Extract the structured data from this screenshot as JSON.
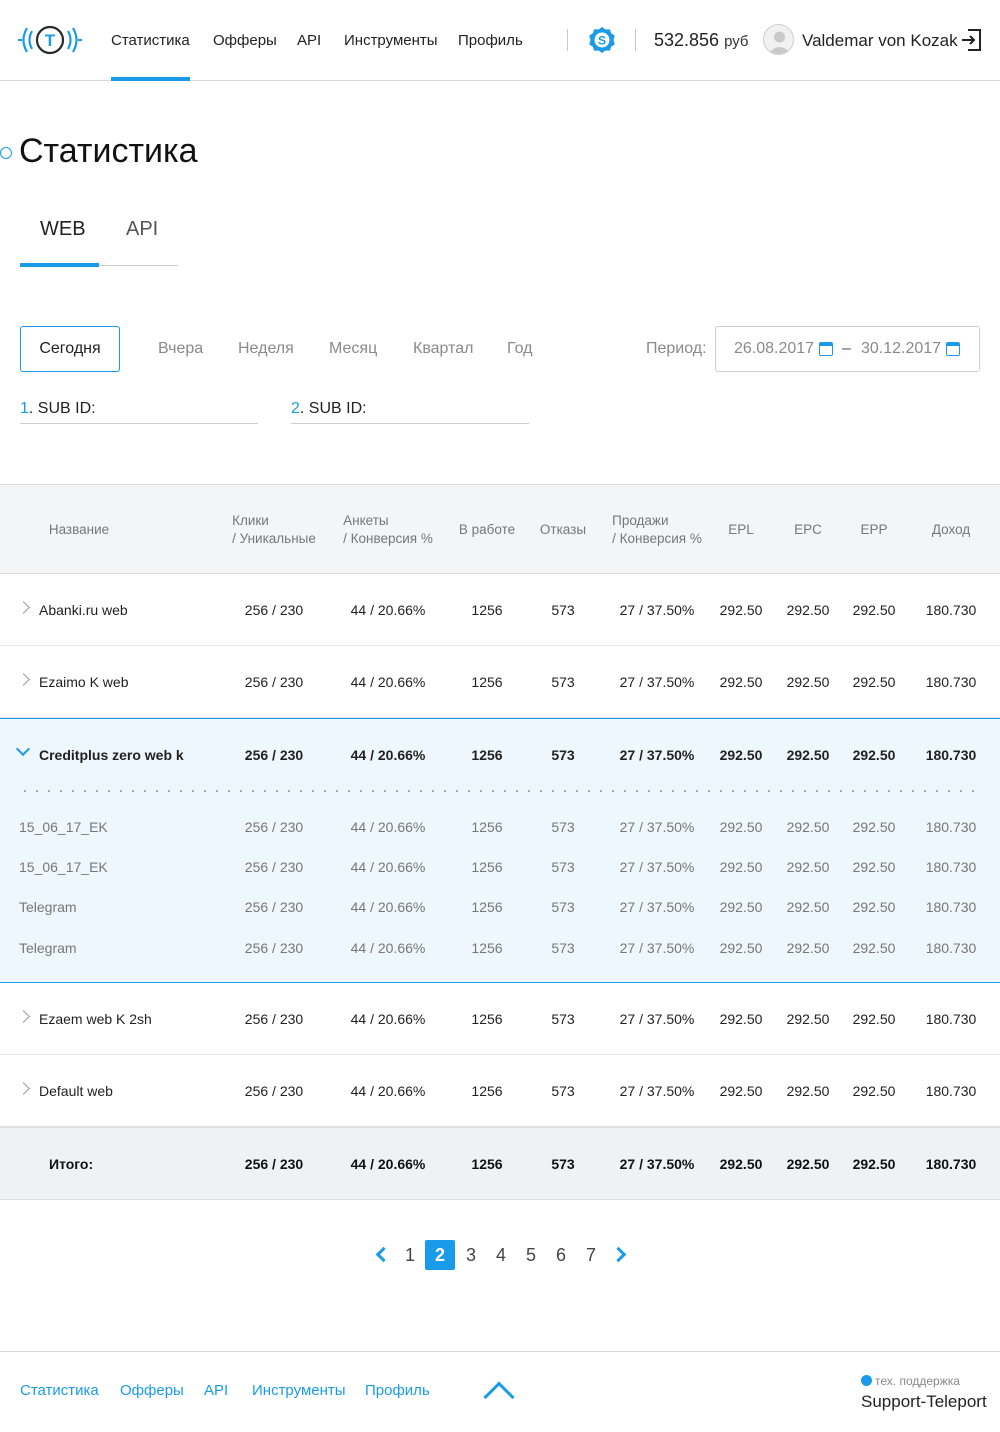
{
  "header": {
    "logo_letter": "T",
    "nav": [
      "Статистика",
      "Офферы",
      "API",
      "Инструменты",
      "Профиль"
    ],
    "balance": "532.856",
    "currency": "руб",
    "username": "Valdemar von Kozak"
  },
  "page_title": "Статистика",
  "tabs": [
    "WEB",
    "API"
  ],
  "periods": [
    "Сегодня",
    "Вчера",
    "Неделя",
    "Месяц",
    "Квартал",
    "Год"
  ],
  "period_label": "Период:",
  "date_from": "26.08.2017",
  "date_to": "30.12.2017",
  "date_dash": "–",
  "sub_ids": [
    {
      "num": "1",
      "label": ". SUB ID:"
    },
    {
      "num": "2",
      "label": ". SUB ID:"
    }
  ],
  "table": {
    "columns": [
      [
        "Название"
      ],
      [
        "Клики",
        "/ Уникальные"
      ],
      [
        "Анкеты",
        "/ Конверсия %"
      ],
      [
        "В работе"
      ],
      [
        "Отказы"
      ],
      [
        "Продажи",
        "/ Конверсия %"
      ],
      [
        "EPL"
      ],
      [
        "EPC"
      ],
      [
        "EPP"
      ],
      [
        "Доход"
      ]
    ],
    "rows": [
      [
        "Abanki.ru web",
        "256 / 230",
        "44 / 20.66%",
        "1256",
        "573",
        "27 / 37.50%",
        "292.50",
        "292.50",
        "292.50",
        "180.730"
      ],
      [
        "Ezaimo K web",
        "256 / 230",
        "44 / 20.66%",
        "1256",
        "573",
        "27 / 37.50%",
        "292.50",
        "292.50",
        "292.50",
        "180.730"
      ],
      [
        "Creditplus zero web k",
        "256 / 230",
        "44 / 20.66%",
        "1256",
        "573",
        "27 / 37.50%",
        "292.50",
        "292.50",
        "292.50",
        "180.730"
      ],
      [
        "Ezaem web K 2sh",
        "256 / 230",
        "44 / 20.66%",
        "1256",
        "573",
        "27 / 37.50%",
        "292.50",
        "292.50",
        "292.50",
        "180.730"
      ],
      [
        "Default web",
        "256 / 230",
        "44 / 20.66%",
        "1256",
        "573",
        "27 / 37.50%",
        "292.50",
        "292.50",
        "292.50",
        "180.730"
      ]
    ],
    "expanded_row_index": 2,
    "sub_rows": [
      [
        "15_06_17_EK",
        "256 / 230",
        "44 / 20.66%",
        "1256",
        "573",
        "27 / 37.50%",
        "292.50",
        "292.50",
        "292.50",
        "180.730"
      ],
      [
        "15_06_17_EK",
        "256 / 230",
        "44 / 20.66%",
        "1256",
        "573",
        "27 / 37.50%",
        "292.50",
        "292.50",
        "292.50",
        "180.730"
      ],
      [
        "Telegram",
        "256 / 230",
        "44 / 20.66%",
        "1256",
        "573",
        "27 / 37.50%",
        "292.50",
        "292.50",
        "292.50",
        "180.730"
      ],
      [
        "Telegram",
        "256 / 230",
        "44 / 20.66%",
        "1256",
        "573",
        "27 / 37.50%",
        "292.50",
        "292.50",
        "292.50",
        "180.730"
      ]
    ],
    "total": [
      "Итого:",
      "256 / 230",
      "44 / 20.66%",
      "1256",
      "573",
      "27 / 37.50%",
      "292.50",
      "292.50",
      "292.50",
      "180.730"
    ]
  },
  "pagination": {
    "pages": [
      "1",
      "2",
      "3",
      "4",
      "5",
      "6",
      "7"
    ],
    "current": "2"
  },
  "footer": {
    "links": [
      "Статистика",
      "Офферы",
      "API",
      "Инструменты",
      "Профиль"
    ],
    "support_label": "тех. поддержка",
    "support_name": "Support-Teleport"
  },
  "colors": {
    "accent": "#1a9bea",
    "header_bg": "#f4f5f7",
    "expanded_bg": "#eef7fd"
  }
}
